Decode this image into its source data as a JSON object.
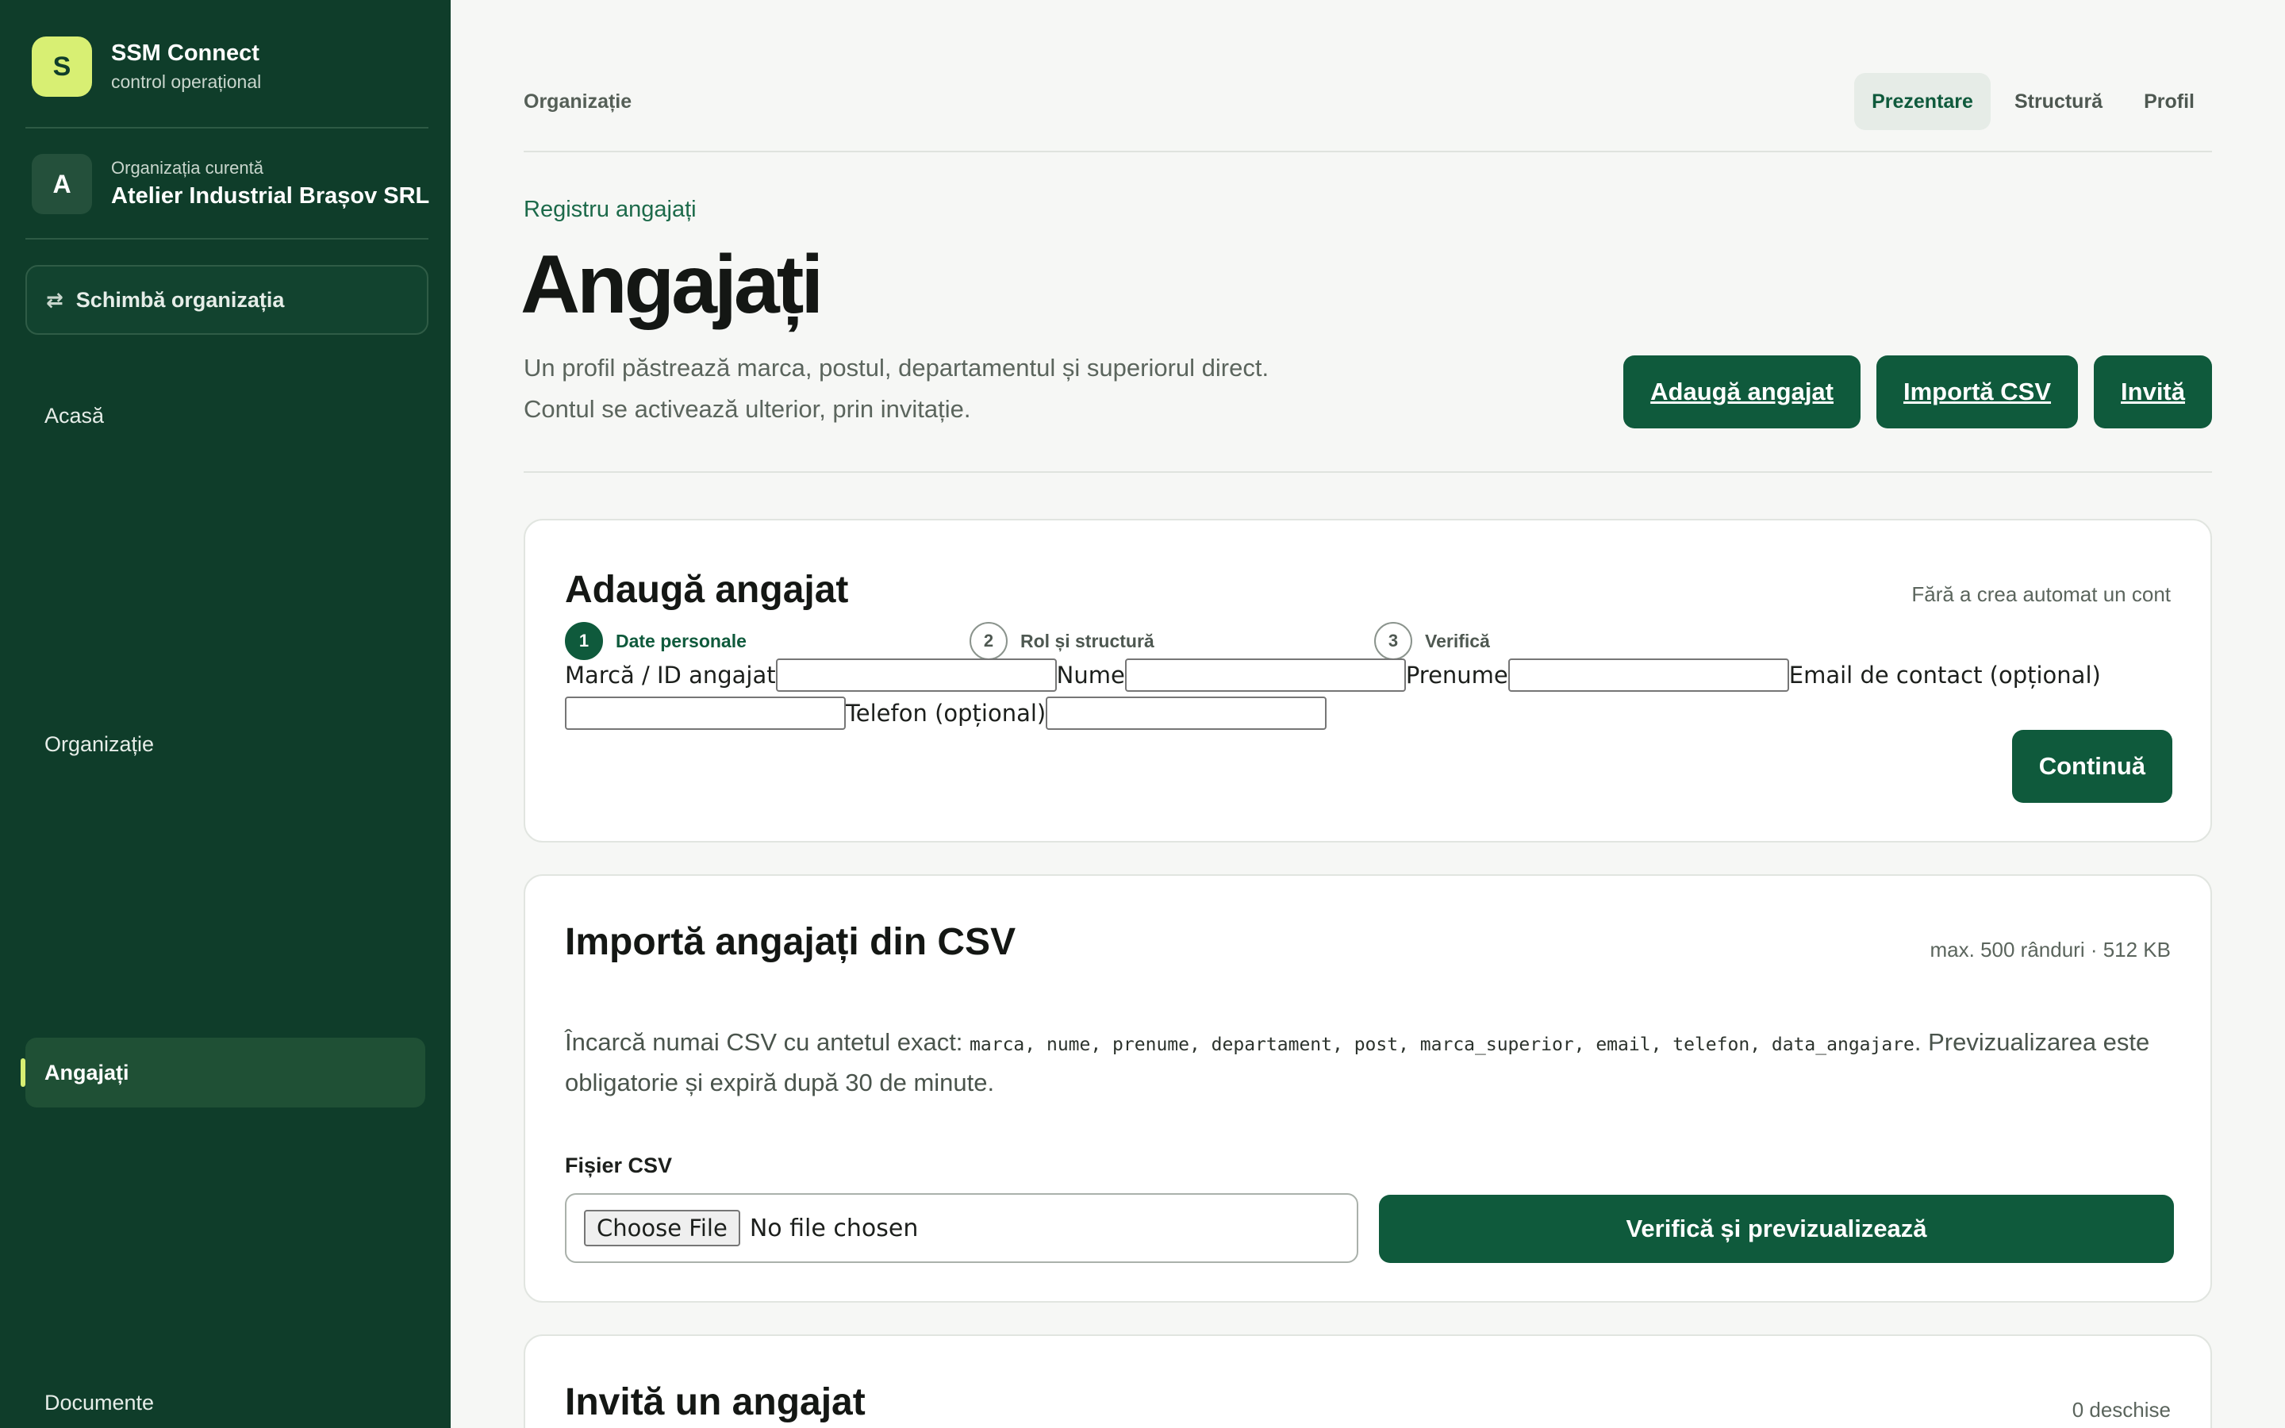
{
  "brand": {
    "logo_letter": "S",
    "name": "SSM Connect",
    "subtitle": "control operațional"
  },
  "organization": {
    "avatar_letter": "A",
    "label": "Organizația curentă",
    "name": "Atelier Industrial Brașov SRL",
    "switch_label": "Schimbă organizația",
    "switch_icon": "swap-arrows-icon"
  },
  "sidebar": {
    "items": [
      {
        "label": "Acasă",
        "active": false
      },
      {
        "label": "Organizație",
        "active": false
      },
      {
        "label": "Angajați",
        "active": true
      },
      {
        "label": "Documente",
        "active": false
      }
    ]
  },
  "topbar": {
    "title": "Organizație",
    "tabs": [
      {
        "label": "Prezentare",
        "active": true
      },
      {
        "label": "Structură",
        "active": false
      },
      {
        "label": "Profil",
        "active": false
      }
    ]
  },
  "header": {
    "eyebrow": "Registru angajați",
    "title": "Angajați",
    "description_line1": "Un profil păstrează marca, postul, departamentul și superiorul direct.",
    "description_line2": "Contul se activează ulterior, prin invitație.",
    "actions": [
      "Adaugă angajat",
      "Importă CSV",
      "Invită"
    ]
  },
  "add_employee": {
    "title": "Adaugă angajat",
    "meta": "Fără a crea automat un cont",
    "steps": [
      {
        "number": "1",
        "label": "Date personale",
        "active": true
      },
      {
        "number": "2",
        "label": "Rol și structură",
        "active": false
      },
      {
        "number": "3",
        "label": "Verifică",
        "active": false
      }
    ],
    "fields": {
      "marca_label": "Marcă / ID angajat",
      "nume_label": "Nume",
      "prenume_label": "Prenume",
      "email_label": "Email de contact (opțional)",
      "telefon_label": "Telefon (opțional)",
      "marca_value": "",
      "nume_value": "",
      "prenume_value": "",
      "email_value": "",
      "telefon_value": ""
    },
    "continue_label": "Continuă"
  },
  "import_csv": {
    "title": "Importă angajați din CSV",
    "meta": "max. 500 rânduri · 512 KB",
    "desc_prefix": "Încarcă numai CSV cu antetul exact: ",
    "columns": "marca, nume, prenume, departament, post, marca_superior, email, telefon, data_angajare",
    "desc_suffix": ". Previzualizarea este obligatorie și expiră după 30 de minute.",
    "file_label": "Fișier CSV",
    "choose_file_label": "Choose File",
    "no_file_label": "No file chosen",
    "verify_label": "Verifică și previzualizează"
  },
  "invite": {
    "title": "Invită un angajat",
    "meta": "0 deschise"
  },
  "colors": {
    "sidebar_bg": "#0f3d2a",
    "accent": "#0f5a3c",
    "logo_bg": "#d8ef73",
    "page_bg": "#f6f7f5"
  }
}
